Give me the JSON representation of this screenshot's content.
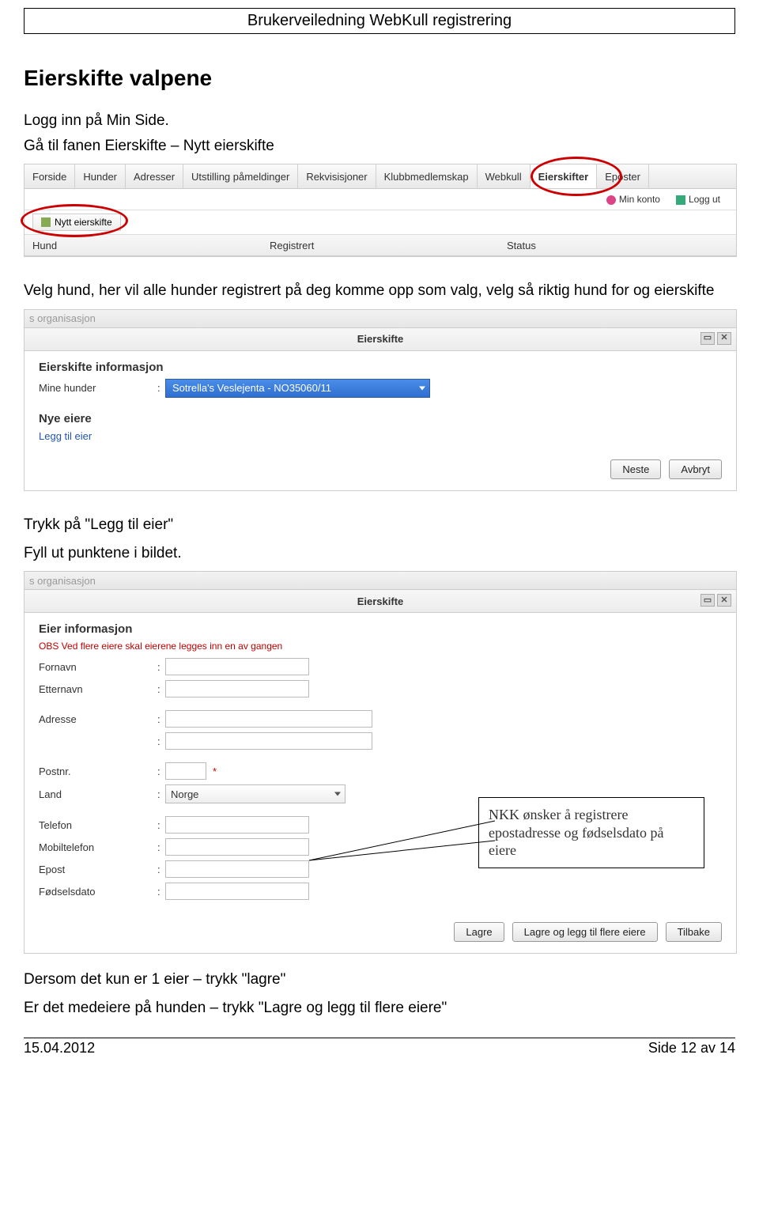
{
  "header": "Brukerveiledning WebKull registrering",
  "section_title": "Eierskifte valpene",
  "intro_1": "Logg inn på Min Side.",
  "intro_2": "Gå til fanen Eierskifte – Nytt eierskifte",
  "shot1": {
    "tabs": [
      "Forside",
      "Hunder",
      "Adresser",
      "Utstilling påmeldinger",
      "Rekvisisjoner",
      "Klubbmedlemskap",
      "Webkull",
      "Eierskifter",
      "Eposter"
    ],
    "util": {
      "account": "Min konto",
      "logout": "Logg ut"
    },
    "subtab": "Nytt eierskifte",
    "cols": [
      "Hund",
      "Registrert",
      "Status"
    ]
  },
  "mid_text": "Velg hund, her vil alle hunder registrert på deg komme opp som valg, velg så riktig hund for og eierskifte",
  "shot2": {
    "faded": "s organisasjon",
    "title": "Eierskifte",
    "heading": "Eierskifte informasjon",
    "mine_label": "Mine hunder",
    "dropdown_value": "Sotrella's Veslejenta - NO35060/11",
    "nye_heading": "Nye eiere",
    "legg_link": "Legg til eier",
    "btn_next": "Neste",
    "btn_cancel": "Avbryt"
  },
  "after2_a": "Trykk på \"Legg til eier\"",
  "after2_b": "Fyll ut punktene i bildet.",
  "shot3": {
    "faded": "s organisasjon",
    "title": "Eierskifte",
    "heading": "Eier informasjon",
    "warning": "OBS Ved flere eiere skal eierene legges inn en av gangen",
    "labels": {
      "fornavn": "Fornavn",
      "etternavn": "Etternavn",
      "adresse": "Adresse",
      "postnr": "Postnr.",
      "land": "Land",
      "telefon": "Telefon",
      "mobil": "Mobiltelefon",
      "epost": "Epost",
      "fdato": "Fødselsdato"
    },
    "land_value": "Norge",
    "btn_save": "Lagre",
    "btn_save_more": "Lagre og legg til flere eiere",
    "btn_back": "Tilbake"
  },
  "callout": "NKK ønsker å registrere epostadresse og fødselsdato på eiere",
  "closing_1": "Dersom det kun er 1 eier – trykk \"lagre\"",
  "closing_2": "Er det medeiere på hunden – trykk \"Lagre og legg til flere eiere\"",
  "footer": {
    "date": "15.04.2012",
    "page": "Side 12 av 14"
  }
}
